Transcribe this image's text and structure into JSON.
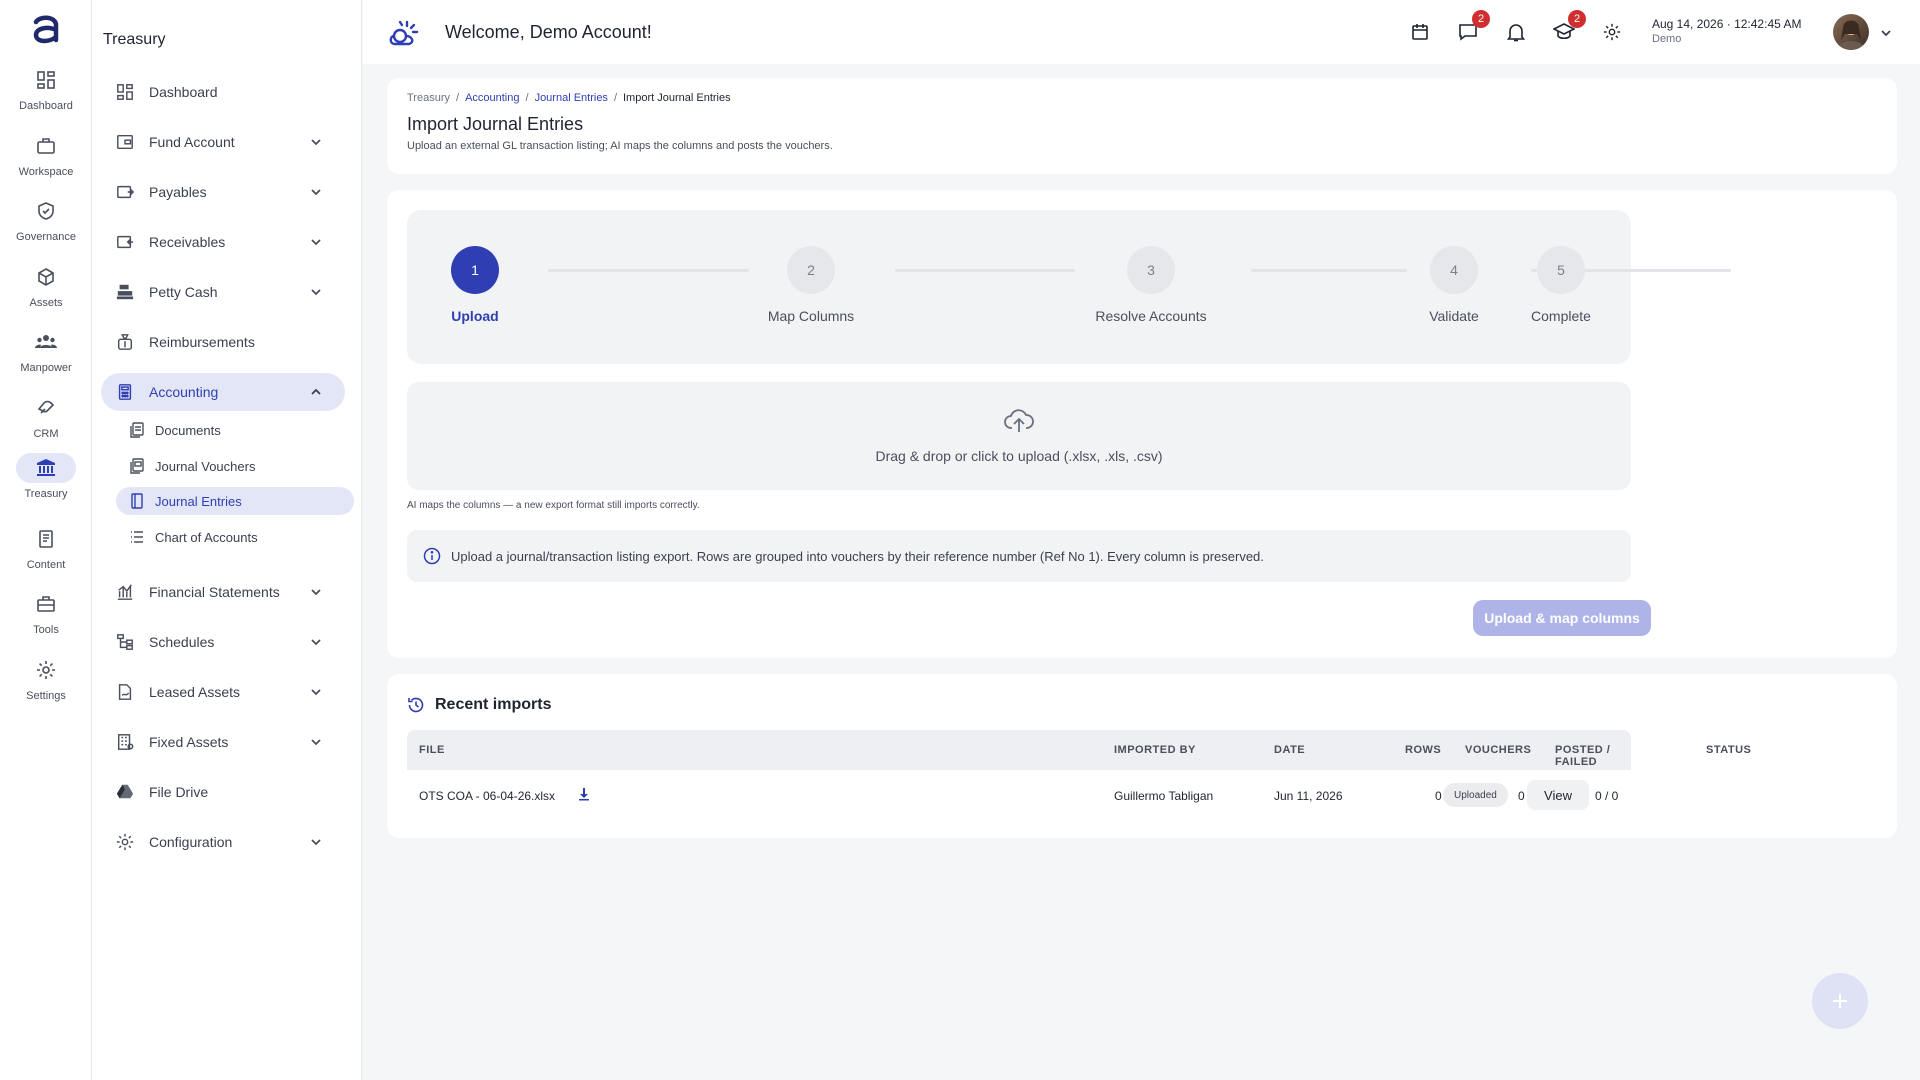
{
  "rail": {
    "items": [
      {
        "label": "Dashboard",
        "icon": "dashboard-icon"
      },
      {
        "label": "Workspace",
        "icon": "briefcase-icon"
      },
      {
        "label": "Governance",
        "icon": "shield-check-icon"
      },
      {
        "label": "Assets",
        "icon": "cube-icon"
      },
      {
        "label": "Manpower",
        "icon": "people-icon"
      },
      {
        "label": "CRM",
        "icon": "handshake-icon"
      },
      {
        "label": "Treasury",
        "icon": "bank-icon"
      },
      {
        "label": "Content",
        "icon": "document-icon"
      },
      {
        "label": "Tools",
        "icon": "toolbox-icon"
      },
      {
        "label": "Settings",
        "icon": "gear-icon"
      }
    ],
    "active": "Treasury"
  },
  "sidebar": {
    "title": "Treasury",
    "items": [
      {
        "label": "Dashboard"
      },
      {
        "label": "Fund Account"
      },
      {
        "label": "Payables"
      },
      {
        "label": "Receivables"
      },
      {
        "label": "Petty Cash"
      },
      {
        "label": "Reimbursements"
      },
      {
        "label": "Accounting"
      },
      {
        "label": "Financial Statements"
      },
      {
        "label": "Schedules"
      },
      {
        "label": "Leased Assets"
      },
      {
        "label": "Fixed Assets"
      },
      {
        "label": "File Drive"
      },
      {
        "label": "Configuration"
      }
    ],
    "sub_items": [
      {
        "label": "Documents"
      },
      {
        "label": "Journal Vouchers"
      },
      {
        "label": "Journal Entries"
      },
      {
        "label": "Chart of Accounts"
      }
    ]
  },
  "topbar": {
    "welcome": "Welcome, Demo Account!",
    "messages_badge": "2",
    "academy_badge": "2",
    "date": "Aug 14, 2026",
    "time": "12:42:45 AM",
    "user": "Demo"
  },
  "header": {
    "breadcrumb": [
      "Treasury",
      "Accounting",
      "Journal Entries",
      "Import Journal Entries"
    ],
    "title": "Import Journal Entries",
    "subtitle": "Upload an external GL transaction listing; AI maps the columns and posts the vouchers."
  },
  "steps": [
    {
      "number": "1",
      "label": "Upload"
    },
    {
      "number": "2",
      "label": "Map Columns"
    },
    {
      "number": "3",
      "label": "Resolve Accounts"
    },
    {
      "number": "4",
      "label": "Validate"
    },
    {
      "number": "5",
      "label": "Complete"
    }
  ],
  "upload": {
    "dropzone_text": "Drag & drop or click to upload (.xlsx, .xls, .csv)",
    "ai_note": "AI maps the columns — a new export format still imports correctly.",
    "info": "Upload a journal/transaction listing export. Rows are grouped into vouchers by their reference number (Ref No 1). Every column is preserved.",
    "button": "Upload & map columns"
  },
  "recent": {
    "title": "Recent imports",
    "columns": [
      "FILE",
      "IMPORTED BY",
      "DATE",
      "ROWS",
      "VOUCHERS",
      "POSTED / FAILED",
      "STATUS"
    ],
    "rows": [
      {
        "file": "OTS COA - 06-04-26.xlsx",
        "imported_by": "Guillermo Tabligan",
        "date": "Jun 11, 2026",
        "rows": "0",
        "vouchers": "0",
        "posted_failed": "0 / 0",
        "status": "Uploaded",
        "action": "View"
      }
    ]
  },
  "colors": {
    "accent": "#2f3fb3",
    "active_bg": "#e3e6f6",
    "badge": "#d12f2f"
  }
}
